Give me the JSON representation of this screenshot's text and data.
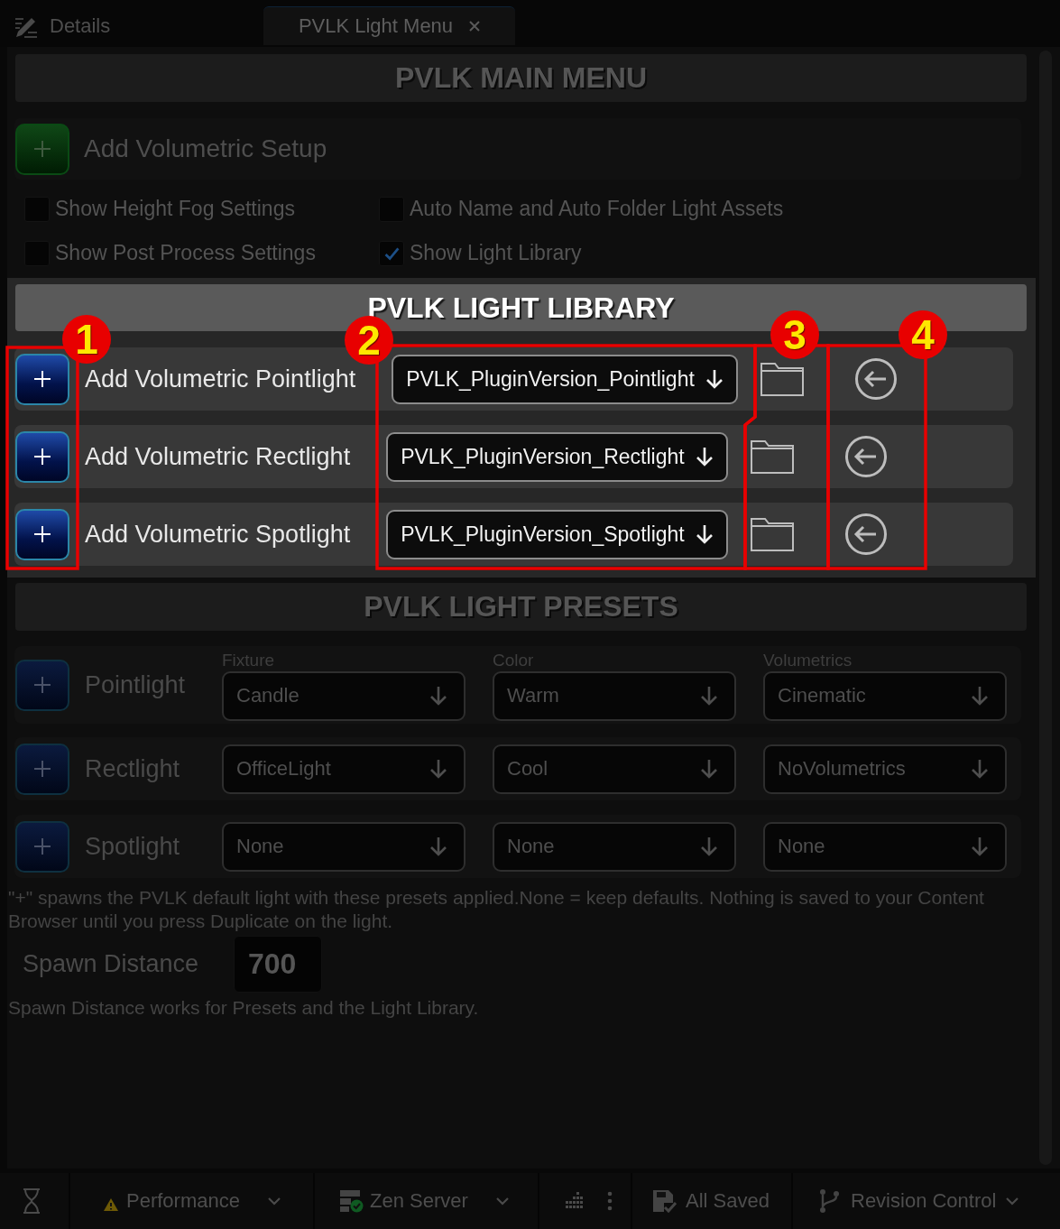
{
  "tabs": [
    {
      "label": "Details",
      "selected": false,
      "closable": false
    },
    {
      "label": "PVLK Light Menu",
      "selected": true,
      "closable": true
    }
  ],
  "main_menu": {
    "title": "PVLK MAIN MENU",
    "setup_label": "Add Volumetric Setup",
    "options": [
      {
        "label": "Show Height Fog Settings",
        "checked": false
      },
      {
        "label": "Auto Name and Auto Folder Light Assets",
        "checked": false
      },
      {
        "label": "Show Post Process Settings",
        "checked": false
      },
      {
        "label": "Show Light Library",
        "checked": true
      }
    ]
  },
  "light_library": {
    "title": "PVLK LIGHT LIBRARY",
    "rows": [
      {
        "label": "Add Volumetric Pointlight",
        "asset": "PVLK_PluginVersion_Pointlight"
      },
      {
        "label": "Add Volumetric Rectlight",
        "asset": "PVLK_PluginVersion_Rectlight"
      },
      {
        "label": "Add Volumetric Spotlight",
        "asset": "PVLK_PluginVersion_Spotlight"
      }
    ]
  },
  "annotations": [
    {
      "label": "1"
    },
    {
      "label": "2"
    },
    {
      "label": "3"
    },
    {
      "label": "4"
    }
  ],
  "light_presets": {
    "title": "PVLK LIGHT PRESETS",
    "columns": [
      "Fixture",
      "Color",
      "Volumetrics"
    ],
    "rows": [
      {
        "label": "Pointlight",
        "values": [
          "Candle",
          "Warm",
          "Cinematic"
        ]
      },
      {
        "label": "Rectlight",
        "values": [
          "OfficeLight",
          "Cool",
          "NoVolumetrics"
        ]
      },
      {
        "label": "Spotlight",
        "values": [
          "None",
          "None",
          "None"
        ]
      }
    ],
    "note": "\"+\" spawns the PVLK default light with these presets applied.None = keep defaults. Nothing is saved to your Content Browser until you press Duplicate on the light.",
    "spawn_distance": {
      "label": "Spawn Distance",
      "value": "700"
    },
    "footnote": "Spawn Distance works for Presets and the Light Library."
  },
  "status_bar": {
    "items": [
      {
        "kind": "performance",
        "label": "Performance",
        "dropdown": true
      },
      {
        "kind": "server",
        "label": "Zen Server",
        "dropdown": true
      },
      {
        "kind": "saved",
        "label": "All Saved",
        "dropdown": false
      },
      {
        "kind": "revision",
        "label": "Revision Control",
        "dropdown": true
      }
    ]
  }
}
